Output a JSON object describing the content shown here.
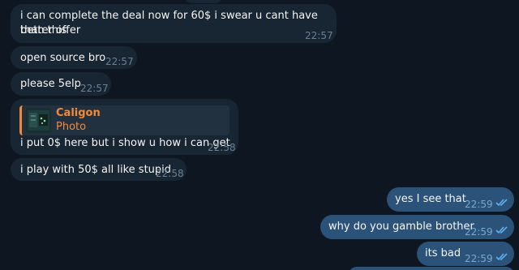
{
  "messages_in": [
    {
      "line1": "i can complete the deal now for 60$ i swear u cant have better offer",
      "line2": "than this",
      "time": "22:57"
    },
    {
      "text": "open source bro",
      "time": "22:57"
    },
    {
      "text": "please 5elp",
      "time": "22:57"
    },
    {
      "reply_name": "Caligon",
      "reply_kind": "Photo",
      "text": "i put 0$ here but i show u how i can get",
      "time": "22:58"
    },
    {
      "text": "i play with 50$ all like stupid",
      "time": "22:58"
    }
  ],
  "messages_out": [
    {
      "text": "yes I see that",
      "time": "22:59"
    },
    {
      "text": "why do you gamble brother",
      "time": "22:59"
    },
    {
      "text": "its bad",
      "time": "22:59"
    }
  ],
  "colors": {
    "background": "#0e1621",
    "incoming_bubble": "#182533",
    "outgoing_bubble": "#2b5278",
    "reply_accent": "#f18a3a",
    "read_ticks": "#5fb0f0"
  },
  "icons": {
    "read_status": "double-check-icon",
    "reply_thumbnail": "photo-thumbnail"
  }
}
